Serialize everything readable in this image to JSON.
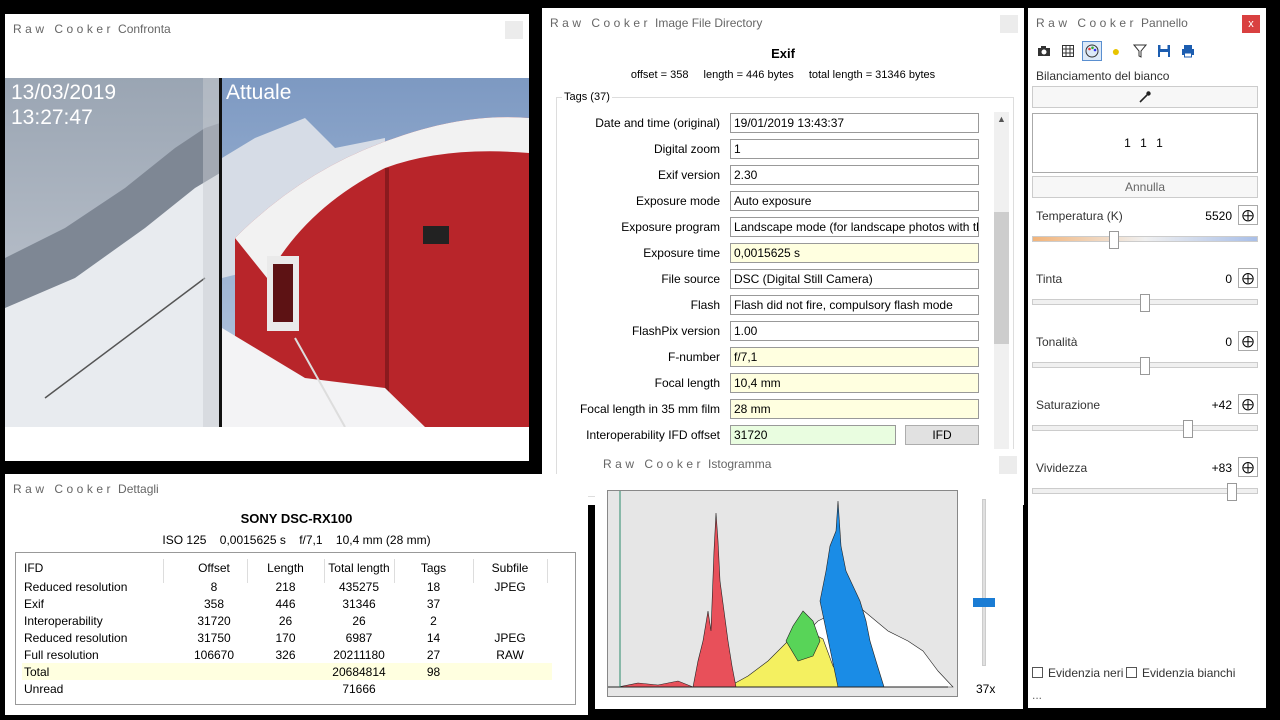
{
  "compare": {
    "title_app": "Raw Cooker",
    "title_sub": "Confronta",
    "close": "",
    "date": "13/03/2019",
    "time": "13:27:47",
    "label_right": "Attuale"
  },
  "ifd": {
    "title_app": "Raw Cooker",
    "title_sub": "Image File Directory",
    "heading": "Exif",
    "offset": "offset = 358",
    "length": "length = 446 bytes",
    "total_length": "total length = 31346 bytes",
    "tags_legend": "Tags (37)",
    "rows": [
      {
        "label": "Date and time (original)",
        "value": "19/01/2019 13:43:37"
      },
      {
        "label": "Digital zoom",
        "value": "1"
      },
      {
        "label": "Exif version",
        "value": "2.30"
      },
      {
        "label": "Exposure mode",
        "value": "Auto exposure"
      },
      {
        "label": "Exposure program",
        "value": "Landscape mode (for landscape photos with the background in focus)"
      },
      {
        "label": "Exposure time",
        "value": "0,0015625 s"
      },
      {
        "label": "File source",
        "value": "DSC (Digital Still Camera)"
      },
      {
        "label": "Flash",
        "value": "Flash did not fire, compulsory flash mode"
      },
      {
        "label": "FlashPix version",
        "value": "1.00"
      },
      {
        "label": "F-number",
        "value": "f/7,1"
      },
      {
        "label": "Focal length",
        "value": "10,4 mm"
      },
      {
        "label": "Focal length in 35 mm film",
        "value": "28 mm"
      },
      {
        "label": "Interoperability IFD offset",
        "value": "31720",
        "button": "IFD"
      }
    ]
  },
  "panel": {
    "title_app": "Raw Cooker",
    "title_sub": "Pannello",
    "close": "x",
    "toolbar": [
      "camera-icon",
      "grid-icon",
      "palette-icon",
      "bulb-icon",
      "filter-icon",
      "save-icon",
      "print-icon"
    ],
    "wb_label": "Bilanciamento del bianco",
    "wb_values": "1 1 1",
    "cancel": "Annulla",
    "sliders": [
      {
        "label": "Temperatura (K)",
        "value": "5520",
        "pos": 0.36
      },
      {
        "label": "Tinta",
        "value": "0",
        "pos": 0.5
      },
      {
        "label": "Tonalità",
        "value": "0",
        "pos": 0.5
      },
      {
        "label": "Saturazione",
        "value": "+42",
        "pos": 0.69
      },
      {
        "label": "Vividezza",
        "value": "+83",
        "pos": 0.89
      }
    ],
    "chk_black": "Evidenzia neri",
    "chk_white": "Evidenzia bianchi",
    "footer": "..."
  },
  "details": {
    "title_app": "Raw Cooker",
    "title_sub": "Dettagli",
    "model": "SONY DSC-RX100",
    "iso": "ISO 125",
    "exposure": "0,0015625 s",
    "fnumber": "f/7,1",
    "focal": "10,4 mm (28 mm)",
    "headers": [
      "IFD",
      "Offset",
      "Length",
      "Total length",
      "Tags",
      "Subfile"
    ],
    "rows": [
      [
        "Reduced resolution",
        "8",
        "218",
        "435275",
        "18",
        "JPEG"
      ],
      [
        "Exif",
        "358",
        "446",
        "31346",
        "37",
        ""
      ],
      [
        "Interoperability",
        "31720",
        "26",
        "26",
        "2",
        ""
      ],
      [
        "Reduced resolution",
        "31750",
        "170",
        "6987",
        "14",
        "JPEG"
      ],
      [
        "Full resolution",
        "106670",
        "326",
        "20211180",
        "27",
        "RAW"
      ],
      [
        "Total",
        "",
        "",
        "20684814",
        "98",
        ""
      ],
      [
        "Unread",
        "",
        "",
        "71666",
        "",
        ""
      ]
    ]
  },
  "histogram": {
    "title_app": "Raw Cooker",
    "title_sub": "Istogramma",
    "close": "",
    "zoom": "37x",
    "zoom_pos": 0.62,
    "colors": {
      "red": "#e8505a",
      "green": "#58d458",
      "blue": "#1a8ce6",
      "yellow": "#f4f060",
      "white": "#ffffff"
    }
  }
}
